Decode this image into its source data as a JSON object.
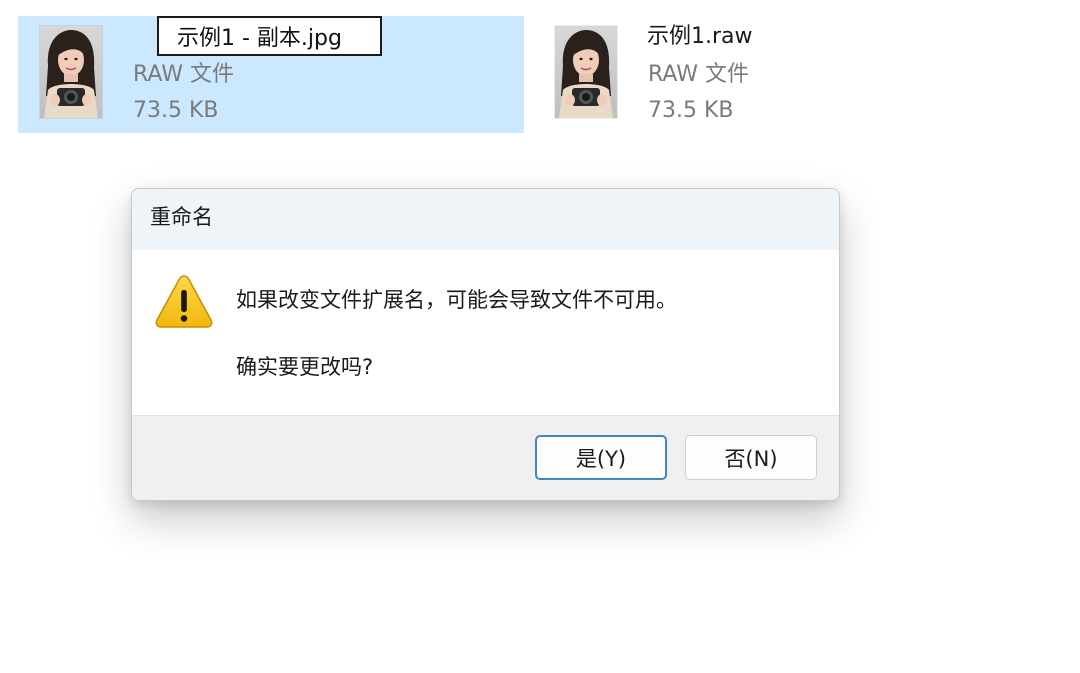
{
  "files": [
    {
      "name": "示例1 - 副本.jpg",
      "type": "RAW 文件",
      "size": "73.5 KB",
      "selected": true,
      "renaming": true
    },
    {
      "name": "示例1.raw",
      "type": "RAW 文件",
      "size": "73.5 KB",
      "selected": false,
      "renaming": false
    }
  ],
  "dialog": {
    "title": "重命名",
    "icon": "warning-icon",
    "message_line1": "如果改变文件扩展名，可能会导致文件不可用。",
    "message_line2": "确实要更改吗?",
    "yes_label": "是(Y)",
    "no_label": "否(N)"
  },
  "colors": {
    "selection": "#cce8ff",
    "dialog_title_bg": "#eff4f9",
    "dialog_footer_bg": "#f0f0f0",
    "primary_button_border": "#3f86c9",
    "warning_fill": "#f7c325",
    "secondary_text": "#7a7a7a"
  }
}
